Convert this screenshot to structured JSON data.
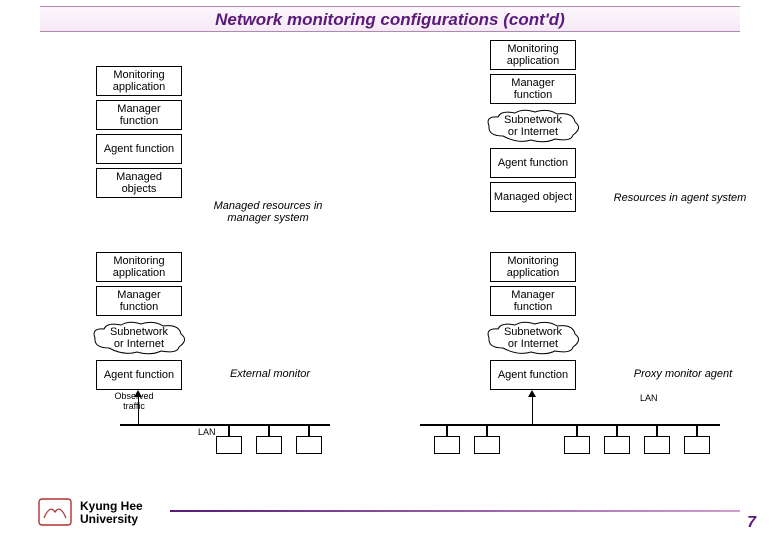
{
  "title": "Network monitoring configurations (cont'd)",
  "left_top": {
    "mon_app": "Monitoring\napplication",
    "mgr_func": "Manager\nfunction",
    "agent_func": "Agent\nfunction",
    "managed_obj": "Managed\nobjects"
  },
  "left_mid_label": "Managed resources in\nmanager system",
  "right_top": {
    "mon_app": "Monitoring\napplication",
    "mgr_func": "Manager\nfunction",
    "subnet": "Subnetwork\nor Internet",
    "agent_func": "Agent\nfunction",
    "managed_obj": "Managed\nobject"
  },
  "right_mid_label": "Resources in agent system",
  "left_bot": {
    "mon_app": "Monitoring\napplication",
    "mgr_func": "Manager\nfunction",
    "subnet": "Subnetwork\nor Internet",
    "agent_func": "Agent\nfunction",
    "observed": "Observed\ntraffic",
    "ext_mon": "External monitor",
    "lan": "LAN"
  },
  "right_bot": {
    "mon_app": "Monitoring\napplication",
    "mgr_func": "Manager\nfunction",
    "subnet": "Subnetwork\nor Internet",
    "agent_func": "Agent\nfunction",
    "proxy": "Proxy monitor agent",
    "lan": "LAN"
  },
  "footer": {
    "uni": "Kyung Hee\nUniversity",
    "page": "7"
  }
}
